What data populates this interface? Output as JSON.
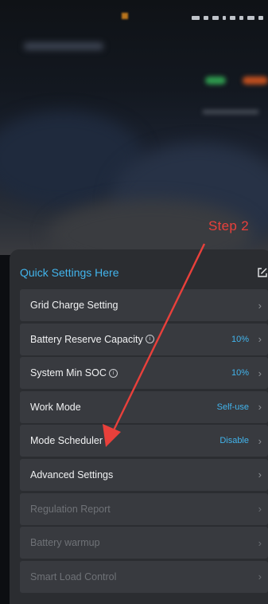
{
  "annotation": {
    "step_label": "Step 2",
    "arrow_color": "#e9403b"
  },
  "sheet": {
    "title": "Quick Settings Here",
    "edit_icon": "edit-icon",
    "accent_color": "#42b4ec",
    "items": [
      {
        "label": "Grid Charge Setting",
        "value": "",
        "info": false,
        "disabled": false
      },
      {
        "label": "Battery Reserve Capacity",
        "value": "10%",
        "info": true,
        "disabled": false
      },
      {
        "label": "System Min SOC",
        "value": "10%",
        "info": true,
        "disabled": false
      },
      {
        "label": "Work Mode",
        "value": "Self-use",
        "info": false,
        "disabled": false
      },
      {
        "label": "Mode Scheduler",
        "value": "Disable",
        "info": false,
        "disabled": false
      },
      {
        "label": "Advanced Settings",
        "value": "",
        "info": false,
        "disabled": false
      },
      {
        "label": "Regulation Report",
        "value": "",
        "info": false,
        "disabled": true
      },
      {
        "label": "Battery warmup",
        "value": "",
        "info": false,
        "disabled": true
      },
      {
        "label": "Smart Load Control",
        "value": "",
        "info": false,
        "disabled": true
      }
    ]
  }
}
